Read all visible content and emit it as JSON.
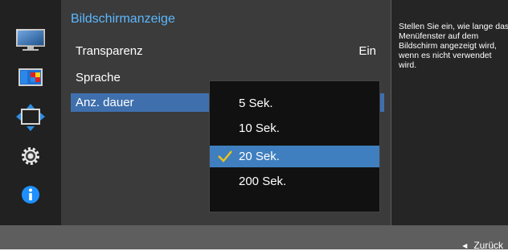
{
  "menu": {
    "title": "Bildschirmanzeige",
    "items": [
      {
        "label": "Transparenz",
        "value": "Ein"
      },
      {
        "label": "Sprache",
        "value": ""
      },
      {
        "label": "Anz. dauer",
        "value": ""
      }
    ],
    "selected_index": 2
  },
  "dropdown": {
    "options": [
      "5 Sek.",
      "10 Sek.",
      "20 Sek.",
      "200 Sek."
    ],
    "selected": "20 Sek."
  },
  "help": {
    "text": "Stellen Sie ein, wie lange das Menüfenster auf dem Bildschirm angezeigt wird, wenn es nicht verwendet wird."
  },
  "footer": {
    "back_label": "Zurück"
  },
  "sidebar": {
    "icons": [
      "monitor-picture-icon",
      "color-icon",
      "size-position-icon",
      "settings-gear-icon",
      "info-icon"
    ]
  },
  "colors": {
    "accent_title": "#5bb8ff",
    "selection": "#3f7fbf",
    "check": "#f0c419",
    "info": "#1e90ff"
  }
}
